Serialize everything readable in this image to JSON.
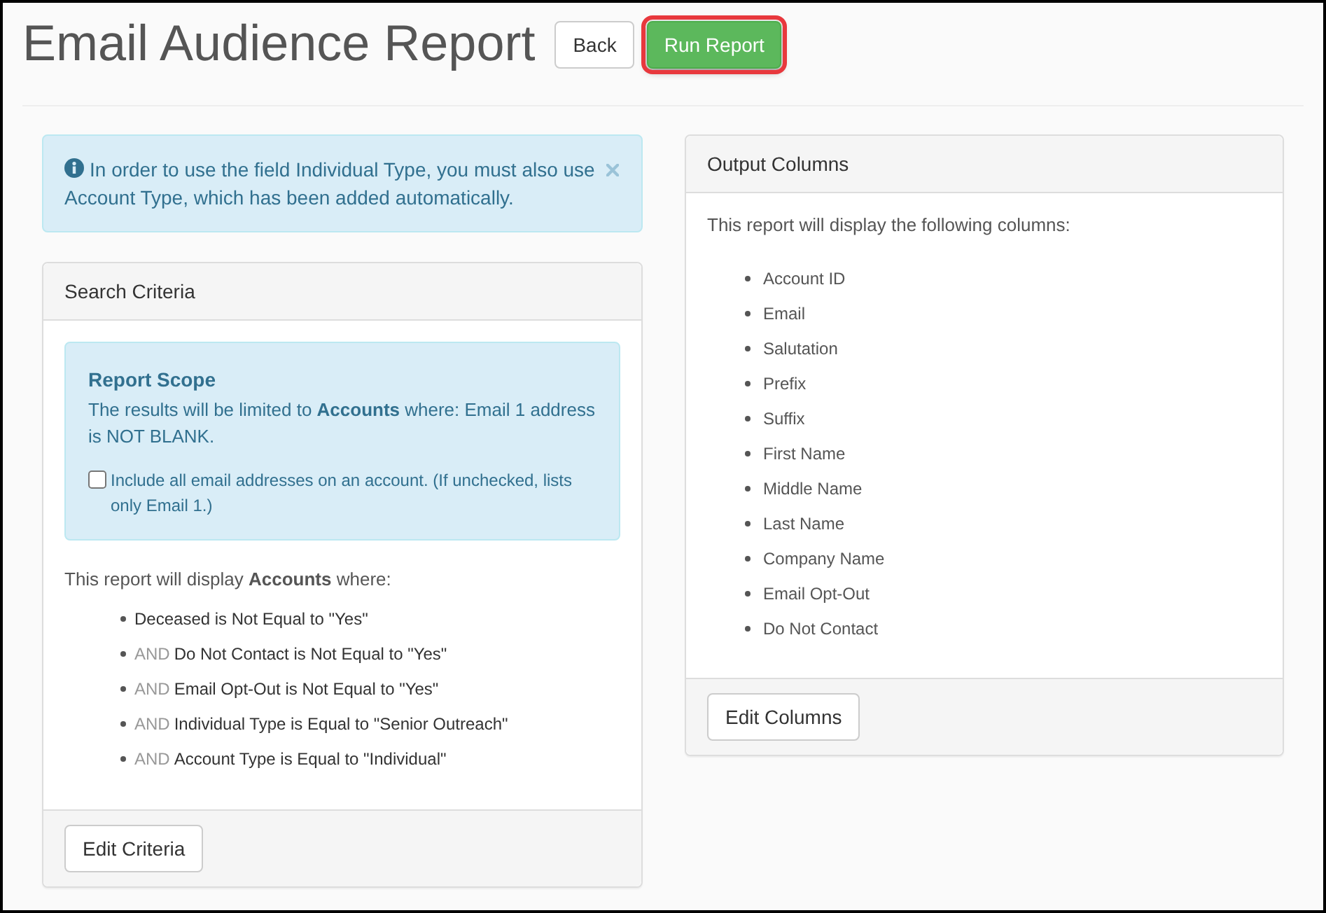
{
  "page": {
    "title": "Email Audience Report"
  },
  "header_buttons": [
    {
      "label": "Back",
      "kind": "default",
      "highlighted": false
    },
    {
      "label": "Run Report",
      "kind": "success",
      "highlighted": true
    }
  ],
  "alert": {
    "message": "In order to use the field Individual Type, you must also use Account Type, which has been added automatically."
  },
  "search_criteria": {
    "title": "Search Criteria",
    "scope": {
      "title": "Report Scope",
      "text": "The results will be limited to **Accounts** where: Email 1 address is NOT BLANK.",
      "checkbox": {
        "label": "Include all email addresses on an account. (If unchecked, lists only Email 1.)",
        "checked": false
      }
    },
    "intro": "This report will display **Accounts** where:",
    "conditions": [
      {
        "text": "Deceased is Not Equal to \"Yes\""
      },
      {
        "connector": "AND",
        "text": "Do Not Contact is Not Equal to \"Yes\""
      },
      {
        "connector": "AND",
        "text": "Email Opt-Out is Not Equal to \"Yes\""
      },
      {
        "connector": "AND",
        "text": "Individual Type is Equal to \"Senior Outreach\""
      },
      {
        "connector": "AND",
        "text": "Account Type is Equal to \"Individual\""
      }
    ],
    "button": "Edit Criteria"
  },
  "output_columns": {
    "title": "Output Columns",
    "intro": "This report will display the following columns:",
    "columns": [
      "Account ID",
      "Email",
      "Salutation",
      "Prefix",
      "Suffix",
      "First Name",
      "Middle Name",
      "Last Name",
      "Company Name",
      "Email Opt-Out",
      "Do Not Contact"
    ],
    "button": "Edit Columns"
  }
}
